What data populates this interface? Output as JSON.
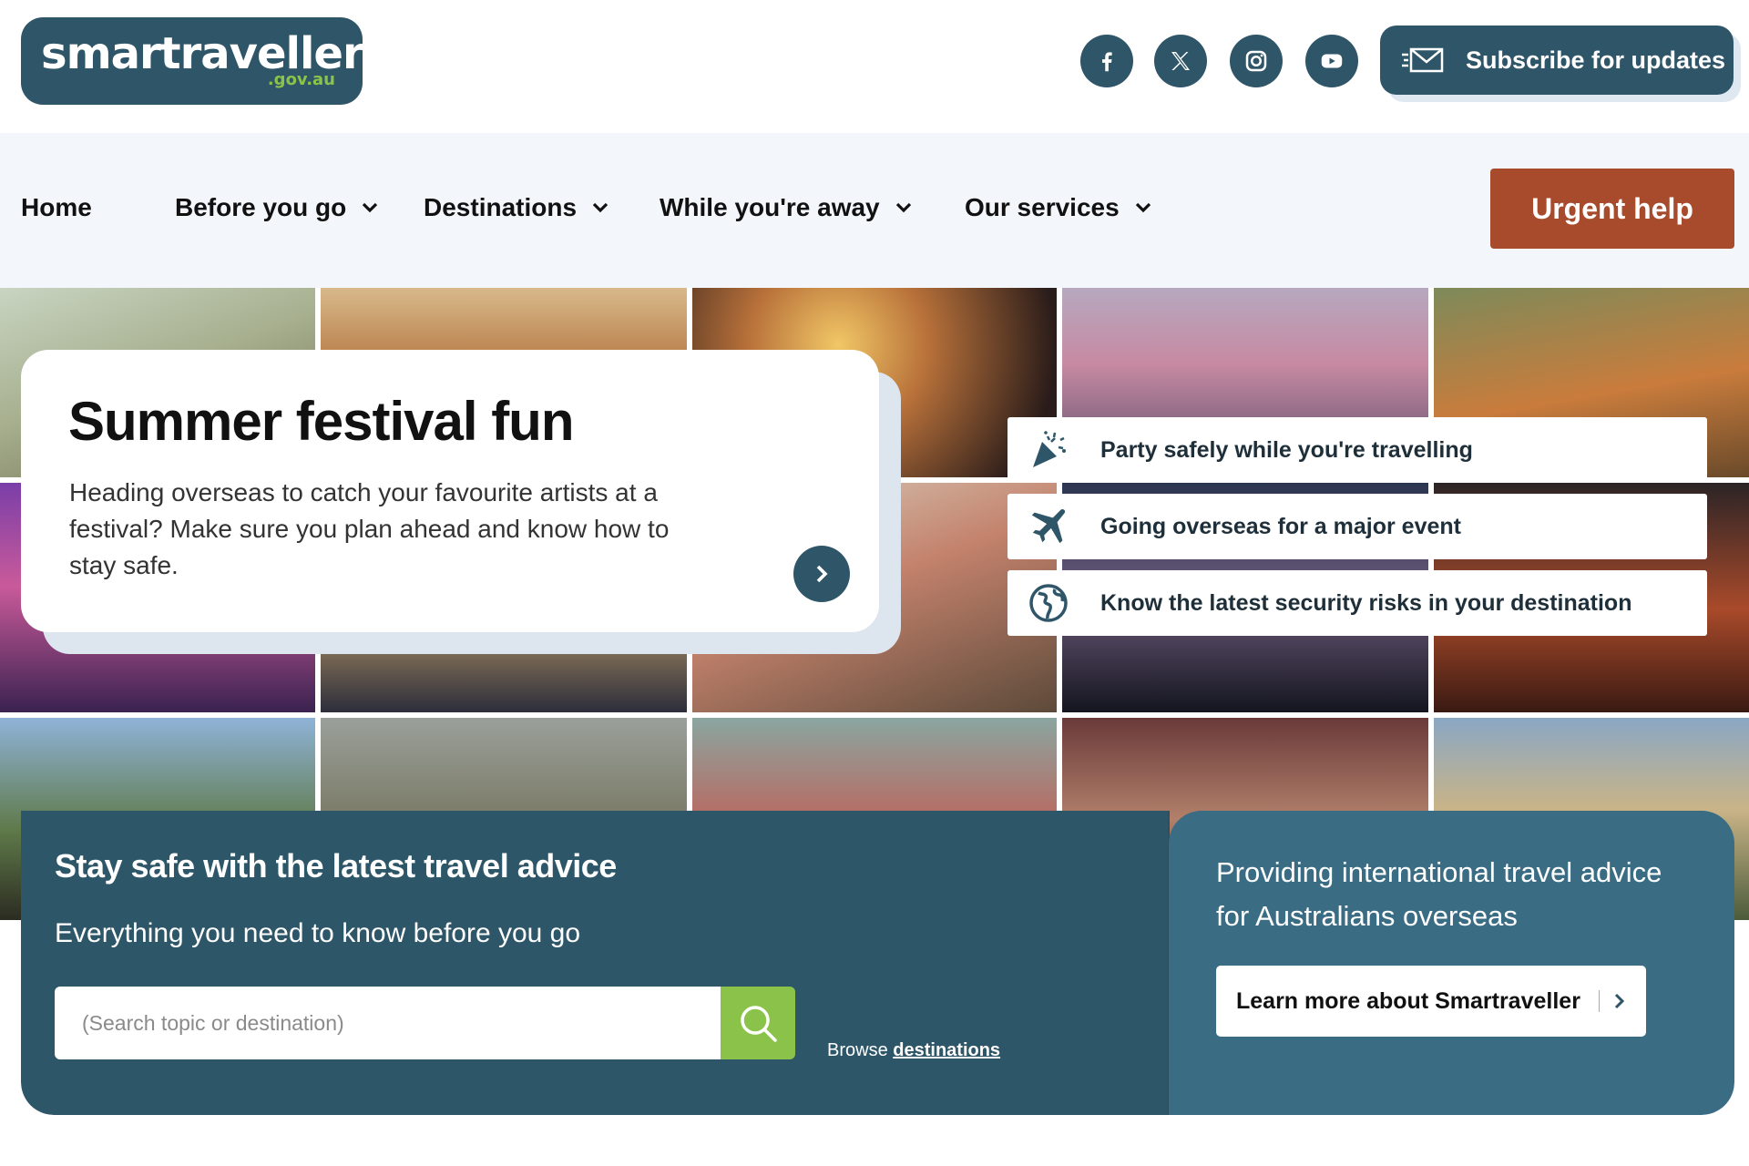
{
  "header": {
    "logo_main": "smartraveller",
    "logo_sub": ".gov.au",
    "social": [
      {
        "name": "facebook-icon"
      },
      {
        "name": "x-icon"
      },
      {
        "name": "instagram-icon"
      },
      {
        "name": "youtube-icon"
      }
    ],
    "subscribe_label": "Subscribe for updates"
  },
  "nav": {
    "items": [
      {
        "label": "Home"
      },
      {
        "label": "Before you go"
      },
      {
        "label": "Destinations"
      },
      {
        "label": "While you're away"
      },
      {
        "label": "Our services"
      }
    ],
    "urgent_label": "Urgent help"
  },
  "feature": {
    "title": "Summer festival fun",
    "text": "Heading overseas to catch your favourite artists at a festival? Make sure you plan ahead and know how to stay safe."
  },
  "quick_links": [
    {
      "label": "Party safely while you're travelling",
      "icon": "party-popper-icon"
    },
    {
      "label": "Going overseas for a major event",
      "icon": "airplane-icon"
    },
    {
      "label": "Know the latest security risks in your destination",
      "icon": "globe-icon"
    }
  ],
  "search_banner": {
    "title": "Stay safe with the latest travel advice",
    "subtitle": "Everything you need to know before you go",
    "search_placeholder": "(Search topic or destination)",
    "browse_prefix": "Browse",
    "browse_link": "destinations",
    "right_text": "Providing international travel advice for Australians overseas",
    "learn_more_label": "Learn more about Smartraveller"
  },
  "colors": {
    "brand": "#2f5568",
    "accent_green": "#8bc34a",
    "urgent": "#a84b2c",
    "nav_bg": "#f3f6fa"
  }
}
